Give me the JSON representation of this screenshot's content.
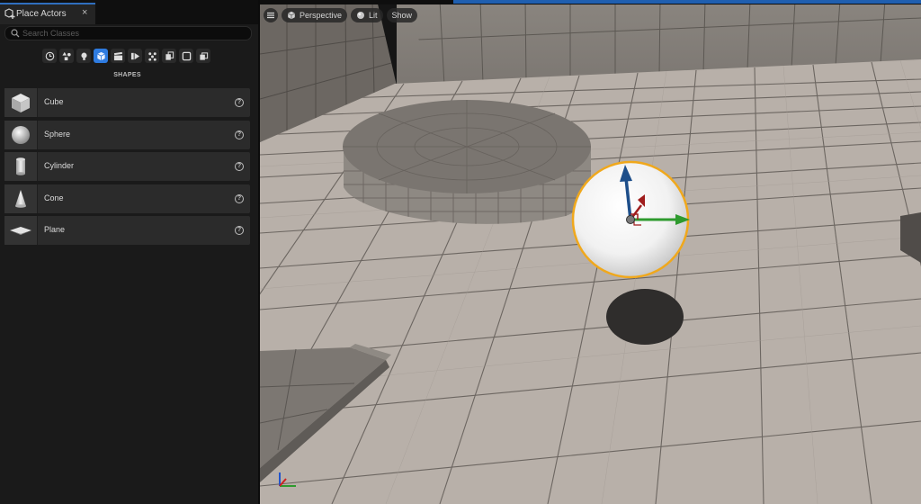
{
  "tab": {
    "title": "Place Actors",
    "close": "×"
  },
  "search": {
    "placeholder": "Search Classes"
  },
  "categories": [
    {
      "icon": "clock-icon",
      "active": false
    },
    {
      "icon": "shapes-mix-icon",
      "active": false
    },
    {
      "icon": "lightbulb-icon",
      "active": false
    },
    {
      "icon": "cube-icon",
      "active": true
    },
    {
      "icon": "clapperboard-icon",
      "active": false
    },
    {
      "icon": "play-media-icon",
      "active": false
    },
    {
      "icon": "effects-icon",
      "active": false
    },
    {
      "icon": "volume-icon",
      "active": false
    },
    {
      "icon": "frame-icon",
      "active": false
    },
    {
      "icon": "all-classes-icon",
      "active": false
    }
  ],
  "section_heading": "SHAPES",
  "shapes": [
    {
      "label": "Cube",
      "icon": "cube-thumbnail"
    },
    {
      "label": "Sphere",
      "icon": "sphere-thumbnail"
    },
    {
      "label": "Cylinder",
      "icon": "cylinder-thumbnail"
    },
    {
      "label": "Cone",
      "icon": "cone-thumbnail"
    },
    {
      "label": "Plane",
      "icon": "plane-thumbnail"
    }
  ],
  "help_glyph": "?",
  "viewport": {
    "menu_icon": "hamburger-icon",
    "perspective_label": "Perspective",
    "lit_label": "Lit",
    "show_label": "Show"
  },
  "colors": {
    "accent": "#2e7be0",
    "selection_outline": "#f0a81c",
    "floor": "#b8b0a9",
    "gizmo_x": "#2e9a2e",
    "gizmo_y": "#a01d1d",
    "gizmo_z": "#1d4e8a"
  }
}
